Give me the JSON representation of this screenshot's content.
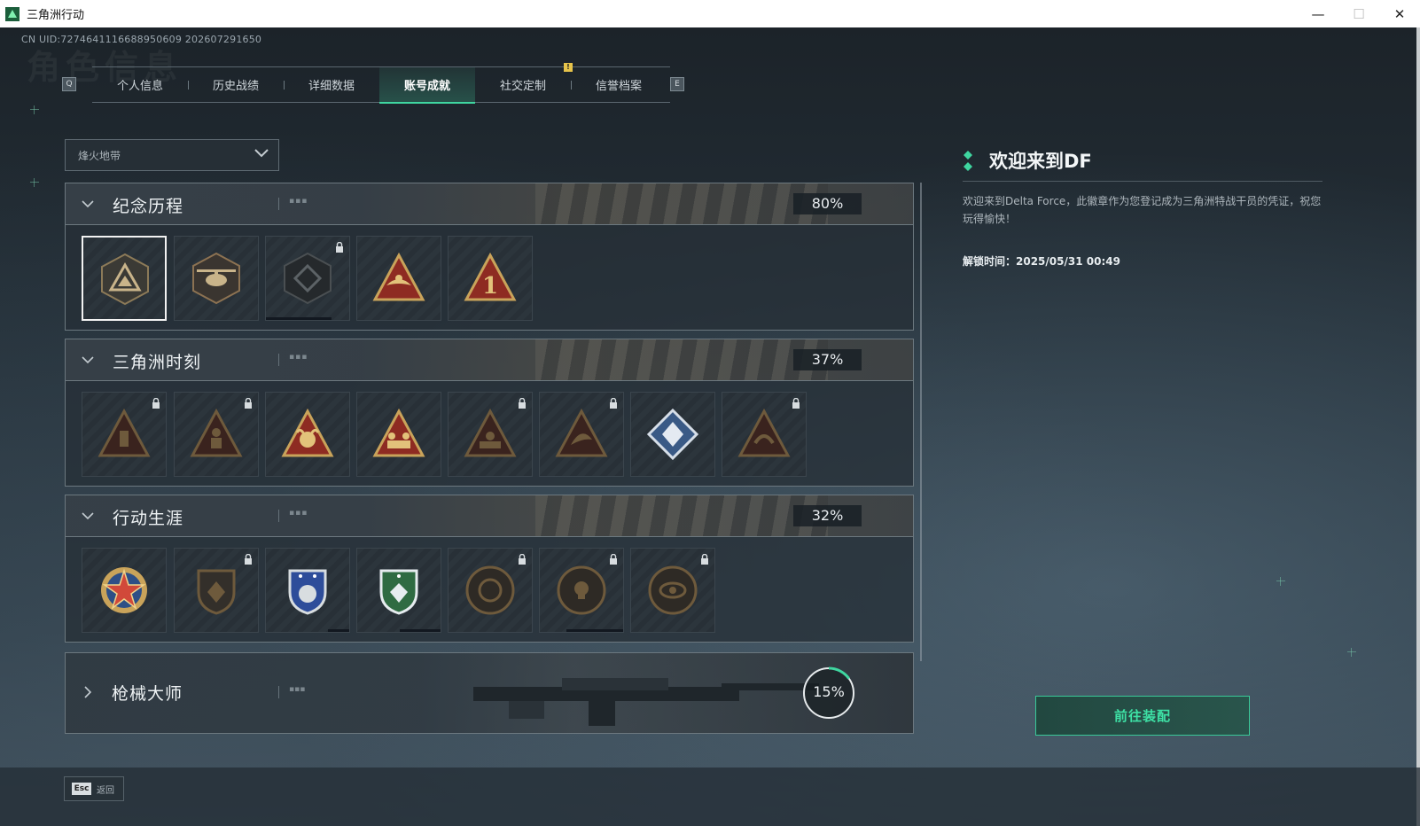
{
  "window": {
    "title": "三角洲行动",
    "controls": [
      "—",
      "☐",
      "✕"
    ]
  },
  "uid_text": "CN UID:7274641116688950609 202607291650",
  "ghost_title": "角色信息",
  "tabs": {
    "left_key": "Q",
    "right_key": "E",
    "items": [
      {
        "label": "个人信息"
      },
      {
        "label": "历史战绩"
      },
      {
        "label": "详细数据"
      },
      {
        "label": "账号成就"
      },
      {
        "label": "社交定制"
      },
      {
        "label": "信誉档案"
      }
    ],
    "active_index": 3,
    "notification_badge": "!"
  },
  "mode_select": {
    "value": "烽火地带"
  },
  "sections": [
    {
      "title": "纪念历程",
      "dots": "▪▪▪",
      "percent": "80%",
      "expanded": true,
      "badges": [
        {
          "icon": "triangle-emblem-icon",
          "locked": false,
          "selected": true
        },
        {
          "icon": "helicopter-emblem-icon",
          "locked": false
        },
        {
          "icon": "shield-crest-icon",
          "locked": true
        },
        {
          "icon": "eagle-triangle-icon",
          "locked": false
        },
        {
          "icon": "number-one-triangle-icon",
          "locked": false
        }
      ]
    },
    {
      "title": "三角洲时刻",
      "dots": "▪▪▪",
      "percent": "37%",
      "expanded": true,
      "badges": [
        {
          "icon": "usb-triangle-icon",
          "locked": true
        },
        {
          "icon": "soldier-triangle-icon",
          "locked": true
        },
        {
          "icon": "bull-triangle-icon",
          "locked": false
        },
        {
          "icon": "squad-triangle-icon",
          "locked": false
        },
        {
          "icon": "team-triangle-icon",
          "locked": true
        },
        {
          "icon": "dolphin-triangle-icon",
          "locked": true
        },
        {
          "icon": "diamond-gem-icon",
          "locked": false
        },
        {
          "icon": "dragon-triangle-icon",
          "locked": true
        }
      ]
    },
    {
      "title": "行动生涯",
      "dots": "▪▪▪",
      "percent": "32%",
      "expanded": true,
      "badges": [
        {
          "icon": "star-medal-icon",
          "locked": false
        },
        {
          "icon": "dark-shield-icon",
          "locked": true
        },
        {
          "icon": "blue-shield-icon",
          "locked": false
        },
        {
          "icon": "green-shield-icon",
          "locked": false
        },
        {
          "icon": "round-seal-icon",
          "locked": true
        },
        {
          "icon": "skull-seal-icon",
          "locked": true
        },
        {
          "icon": "eye-seal-icon",
          "locked": true
        }
      ]
    }
  ],
  "weapon_section": {
    "title": "枪械大师",
    "dots": "▪▪▪",
    "percent": "15%",
    "progress": 0.15,
    "expanded": false
  },
  "detail": {
    "title": "欢迎来到DF",
    "description": "欢迎来到Delta Force，此徽章作为您登记成为三角洲特战干员的凭证，祝您玩得愉快！",
    "unlock_time": "解锁时间：2025/05/31 00:49"
  },
  "equip_button": {
    "label": "前往装配"
  },
  "footer": {
    "key": "Esc",
    "label": "返回"
  },
  "colors": {
    "accent": "#3fd6a0",
    "badge_gold": "#c9a35a",
    "badge_red": "#8e2b22",
    "selected_border": "#f2f2f2"
  }
}
